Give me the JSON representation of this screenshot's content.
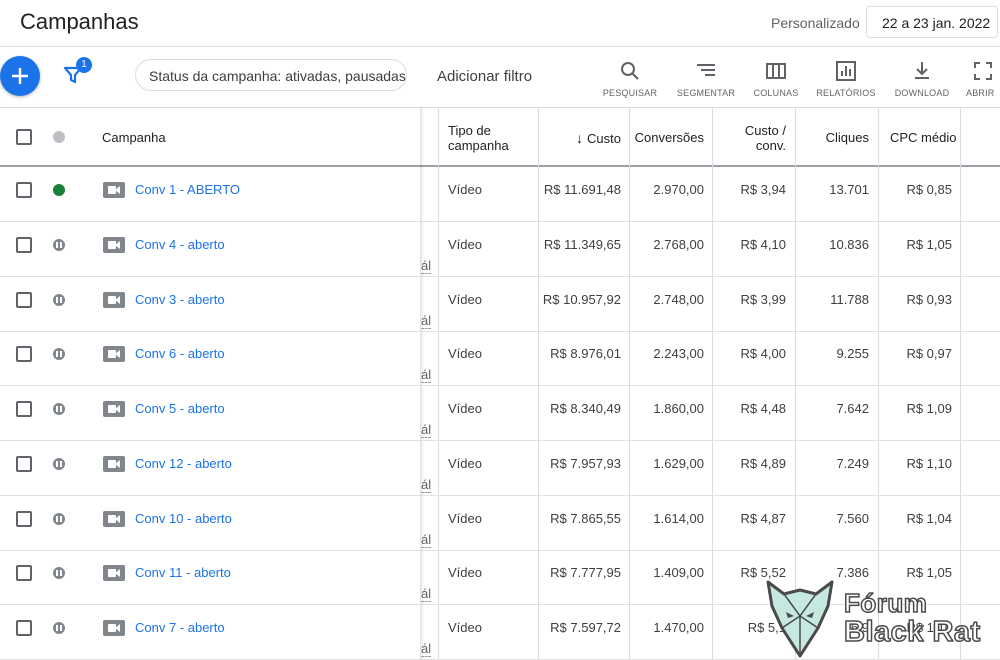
{
  "header": {
    "title": "Campanhas",
    "range_label": "Personalizado",
    "date_range": "22 a 23 jan. 2022"
  },
  "toolbar": {
    "filter_count": "1",
    "filter_chip": "Status da campanha: ativadas, pausadas",
    "add_filter": "Adicionar filtro",
    "tools": [
      {
        "label": "PESQUISAR",
        "icon": "search-icon"
      },
      {
        "label": "SEGMENTAR",
        "icon": "segment-icon"
      },
      {
        "label": "COLUNAS",
        "icon": "columns-icon"
      },
      {
        "label": "RELATÓRIOS",
        "icon": "reports-icon"
      },
      {
        "label": "DOWNLOAD",
        "icon": "download-icon"
      },
      {
        "label": "ABRIR",
        "icon": "expand-icon"
      }
    ]
  },
  "table": {
    "columns": {
      "campaign": "Campanha",
      "type_line1": "Tipo de",
      "type_line2": "campanha",
      "cost": "Custo",
      "conversions": "Conversões",
      "cost_conv_line1": "Custo /",
      "cost_conv_line2": "conv.",
      "clicks": "Cliques",
      "avg_cpc": "CPC médio"
    },
    "truncated_suffix": "ál",
    "rows": [
      {
        "status": "active",
        "name": "Conv 1 - ABERTO",
        "type": "Vídeo",
        "cost": "R$ 11.691,48",
        "conversions": "2.970,00",
        "cost_conv": "R$ 3,94",
        "clicks": "13.701",
        "cpc": "R$ 0,85"
      },
      {
        "status": "paused",
        "name": "Conv 4 - aberto",
        "type": "Vídeo",
        "cost": "R$ 11.349,65",
        "conversions": "2.768,00",
        "cost_conv": "R$ 4,10",
        "clicks": "10.836",
        "cpc": "R$ 1,05"
      },
      {
        "status": "paused",
        "name": "Conv 3 - aberto",
        "type": "Vídeo",
        "cost": "R$ 10.957,92",
        "conversions": "2.748,00",
        "cost_conv": "R$ 3,99",
        "clicks": "11.788",
        "cpc": "R$ 0,93"
      },
      {
        "status": "paused",
        "name": "Conv 6 - aberto",
        "type": "Vídeo",
        "cost": "R$ 8.976,01",
        "conversions": "2.243,00",
        "cost_conv": "R$ 4,00",
        "clicks": "9.255",
        "cpc": "R$ 0,97"
      },
      {
        "status": "paused",
        "name": "Conv 5 - aberto",
        "type": "Vídeo",
        "cost": "R$ 8.340,49",
        "conversions": "1.860,00",
        "cost_conv": "R$ 4,48",
        "clicks": "7.642",
        "cpc": "R$ 1,09"
      },
      {
        "status": "paused",
        "name": "Conv 12 - aberto",
        "type": "Vídeo",
        "cost": "R$ 7.957,93",
        "conversions": "1.629,00",
        "cost_conv": "R$ 4,89",
        "clicks": "7.249",
        "cpc": "R$ 1,10"
      },
      {
        "status": "paused",
        "name": "Conv 10 - aberto",
        "type": "Vídeo",
        "cost": "R$ 7.865,55",
        "conversions": "1.614,00",
        "cost_conv": "R$ 4,87",
        "clicks": "7.560",
        "cpc": "R$ 1,04"
      },
      {
        "status": "paused",
        "name": "Conv 11 - aberto",
        "type": "Vídeo",
        "cost": "R$ 7.777,95",
        "conversions": "1.409,00",
        "cost_conv": "R$ 5,52",
        "clicks": "7.386",
        "cpc": "R$ 1,05"
      },
      {
        "status": "paused",
        "name": "Conv 7 - aberto",
        "type": "Vídeo",
        "cost": "R$ 7.597,72",
        "conversions": "1.470,00",
        "cost_conv": "R$ 5,1",
        "clicks": "6.9",
        "cpc": "R$ 1,10"
      }
    ]
  },
  "watermark": {
    "line1": "Fórum",
    "line2": "Black Rat"
  },
  "colors": {
    "accent": "#1a73e8",
    "active": "#188038",
    "paused": "#80868b"
  }
}
